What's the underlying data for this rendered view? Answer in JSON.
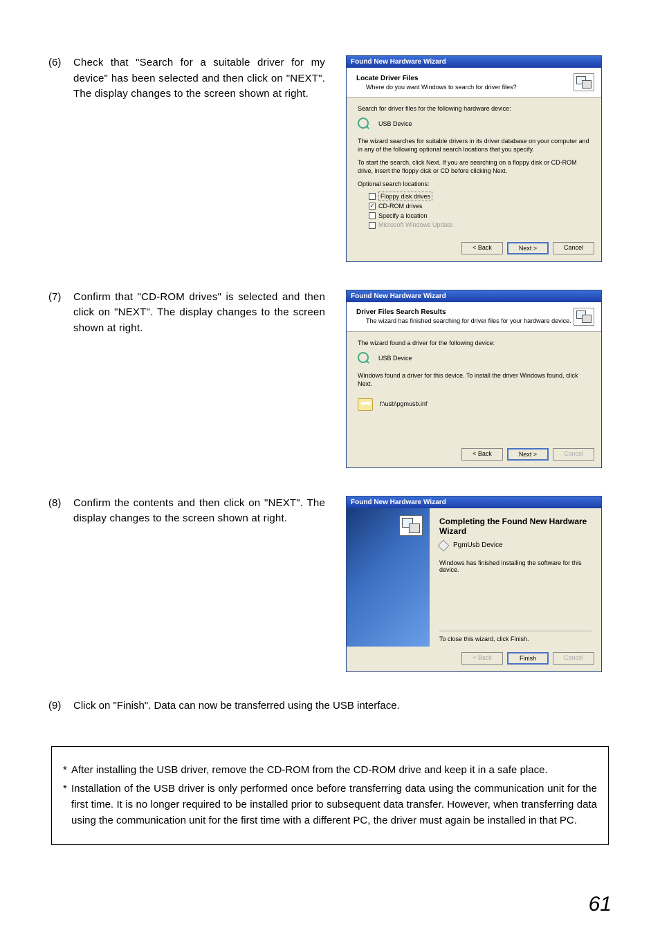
{
  "steps": {
    "s6": {
      "num": "(6)",
      "text": "Check that \"Search for a suitable driver for my device\" has been selected and then click on \"NEXT\".  The display changes to the screen shown at right."
    },
    "s7": {
      "num": "(7)",
      "text": "Confirm that \"CD-ROM drives\" is selected and then click on \"NEXT\".  The display changes to the screen shown at right."
    },
    "s8": {
      "num": "(8)",
      "text": "Confirm the contents and then click on \"NEXT\".  The display changes to the screen shown at right."
    },
    "s9": {
      "num": "(9)",
      "text": "Click on \"Finish\".  Data can now be transferred using the USB interface."
    }
  },
  "dialog1": {
    "title": "Found New Hardware Wizard",
    "header_title": "Locate Driver Files",
    "header_sub": "Where do you want Windows to search for driver files?",
    "line1": "Search for driver files for the following hardware device:",
    "device": "USB Device",
    "line2": "The wizard searches for suitable drivers in its driver database on your computer and in any of the following optional search locations that you specify.",
    "line3": "To start the search, click Next. If you are searching on a floppy disk or CD-ROM drive, insert the floppy disk or CD before clicking Next.",
    "line4": "Optional search locations:",
    "opt_floppy": "Floppy disk drives",
    "opt_cdrom": "CD-ROM drives",
    "opt_specify": "Specify a location",
    "opt_update": "Microsoft Windows Update",
    "btn_back": "< Back",
    "btn_next": "Next >",
    "btn_cancel": "Cancel"
  },
  "dialog2": {
    "title": "Found New Hardware Wizard",
    "header_title": "Driver Files Search Results",
    "header_sub": "The wizard has finished searching for driver files for your hardware device.",
    "line1": "The wizard found a driver for the following device:",
    "device": "USB Device",
    "line2": "Windows found a driver for this device. To install the driver Windows found, click Next.",
    "path": "f:\\usb\\pgmusb.inf",
    "btn_back": "< Back",
    "btn_next": "Next >",
    "btn_cancel": "Cancel"
  },
  "dialog3": {
    "title": "Found New Hardware Wizard",
    "heading": "Completing the Found New Hardware Wizard",
    "device": "PgmUsb Device",
    "msg": "Windows has finished installing the software for this device.",
    "close": "To close this wizard, click Finish.",
    "btn_back": "< Back",
    "btn_finish": "Finish",
    "btn_cancel": "Cancel"
  },
  "notes": {
    "n1": "After installing the USB driver, remove the CD-ROM from the CD-ROM drive and keep it in a safe place.",
    "n2": "Installation of the USB driver is only performed once before transferring data using the communication unit for the first time.  It is no longer required to be installed prior to subsequent data transfer.  However, when transferring data using the communication unit for the first time with a different PC, the driver must again be installed in that PC."
  },
  "page_number": "61"
}
